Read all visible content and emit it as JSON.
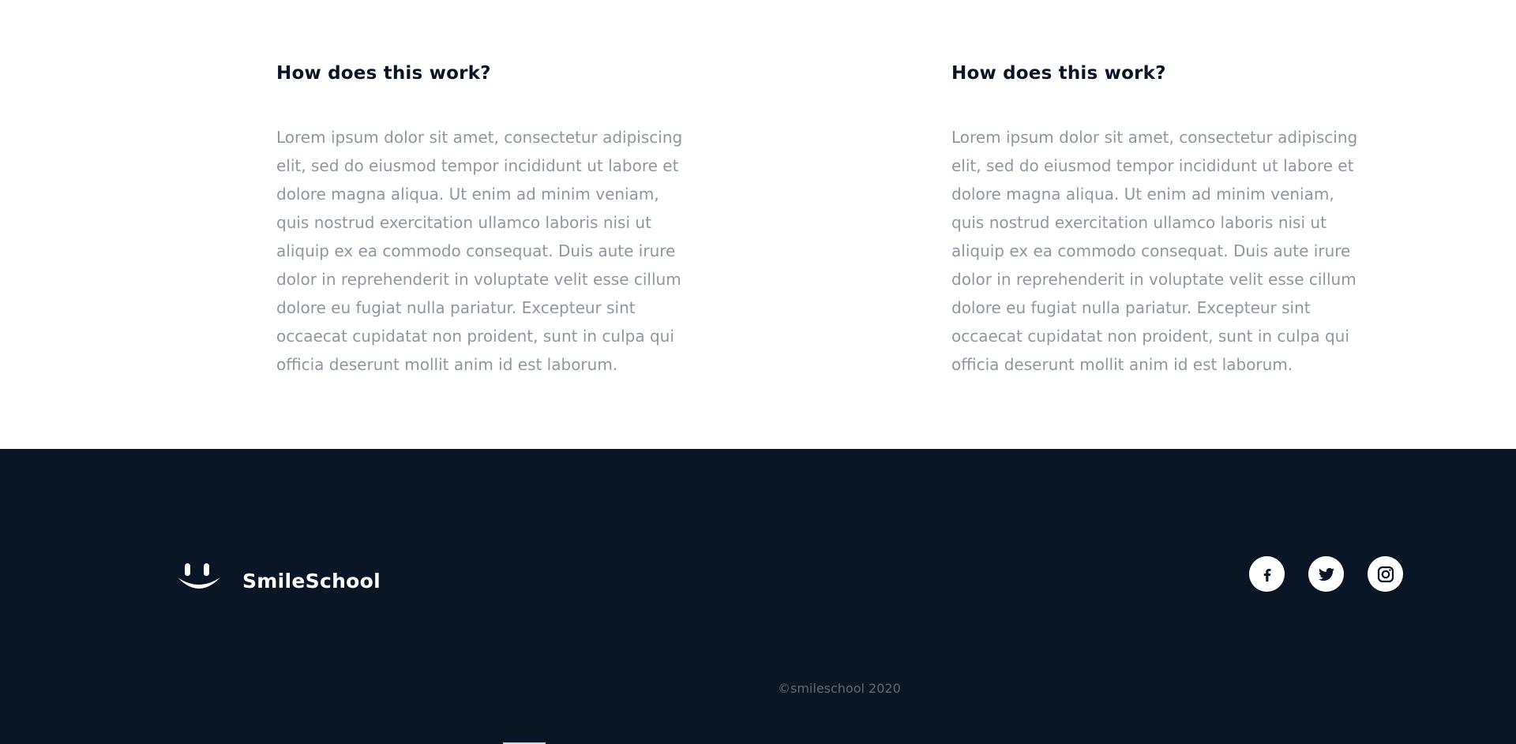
{
  "faq": [
    {
      "title": "How does this work?",
      "body": "Lorem ipsum dolor sit amet, consectetur adipiscing elit, sed do eiusmod tempor incididunt ut labore et dolore magna aliqua. Ut enim ad minim veniam, quis nostrud exercitation ullamco laboris nisi ut aliquip ex ea commodo consequat. Duis aute irure dolor in reprehenderit in voluptate velit esse cillum dolore eu fugiat nulla pariatur. Excepteur sint occaecat cupidatat non proident, sunt in culpa qui officia deserunt mollit anim id est laborum."
    },
    {
      "title": "How does this work?",
      "body": "Lorem ipsum dolor sit amet, consectetur adipiscing elit, sed do eiusmod tempor incididunt ut labore et dolore magna aliqua. Ut enim ad minim veniam, quis nostrud exercitation ullamco laboris nisi ut aliquip ex ea commodo consequat. Duis aute irure dolor in reprehenderit in voluptate velit esse cillum dolore eu fugiat nulla pariatur. Excepteur sint occaecat cupidatat non proident, sunt in culpa qui officia deserunt mollit anim id est laborum."
    }
  ],
  "footer": {
    "brand": "SmileSchool",
    "logo_icon": "smile-logo-icon",
    "social": [
      {
        "name": "facebook-icon"
      },
      {
        "name": "twitter-icon"
      },
      {
        "name": "instagram-icon"
      }
    ],
    "copyright": "©smileschool 2020"
  },
  "colors": {
    "heading": "#0a1628",
    "body_text": "#8f96a0",
    "footer_bg": "#0a1525",
    "copyright": "#5e6878"
  }
}
